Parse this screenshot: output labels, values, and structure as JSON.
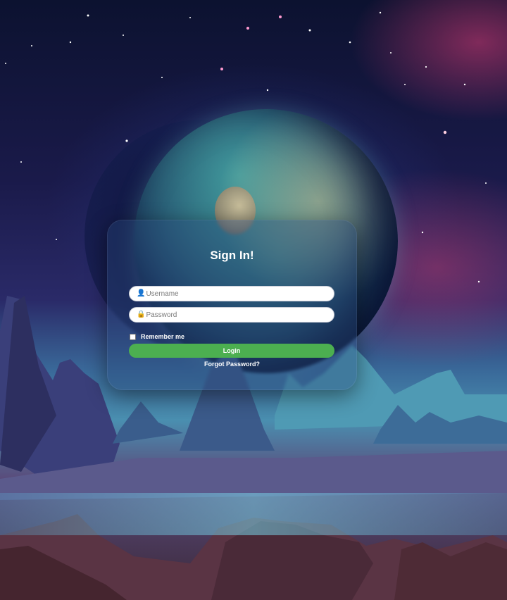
{
  "form": {
    "title": "Sign In!",
    "username_placeholder": "Username",
    "password_placeholder": "Password",
    "username_icon": "user-icon",
    "password_icon": "lock-icon",
    "remember_label": "Remember me",
    "remember_checked": false,
    "login_label": "Login",
    "forgot_label": "Forgot Password?"
  },
  "colors": {
    "login_button": "#4caf50",
    "title_text": "#ffffff"
  }
}
